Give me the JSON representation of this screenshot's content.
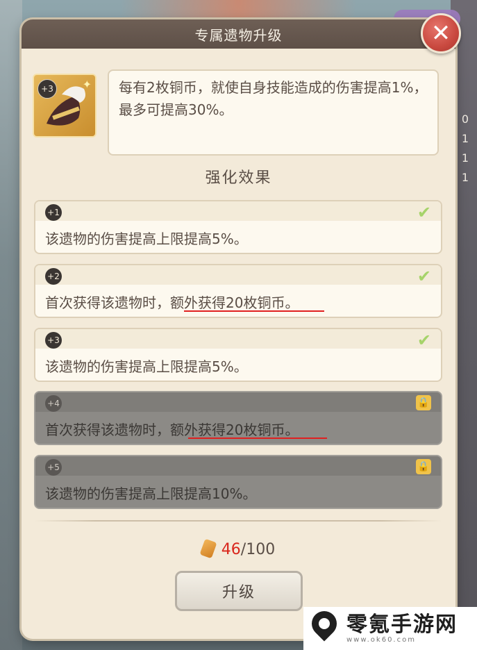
{
  "dialog": {
    "title": "专属遗物升级",
    "close_label": "✕"
  },
  "relic": {
    "level_badge": "+3",
    "description": "每有2枚铜币，就使自身技能造成的伤害提高1%，最多可提高30%。"
  },
  "section_title": "强化效果",
  "effects": [
    {
      "level": "+1",
      "text": "该遗物的伤害提高上限提高5%。",
      "state": "unlocked",
      "status_icon": "check-icon"
    },
    {
      "level": "+2",
      "text_plain": "首次获得该遗物时，",
      "text_highlight": "额外获得20枚铜币。",
      "state": "unlocked",
      "status_icon": "check-icon"
    },
    {
      "level": "+3",
      "text": "该遗物的伤害提高上限提高5%。",
      "state": "unlocked",
      "status_icon": "check-icon"
    },
    {
      "level": "+4",
      "text_plain": "首次获得该遗物时，",
      "text_highlight": "额外获得20枚铜币。",
      "state": "locked",
      "status_icon": "lock-icon"
    },
    {
      "level": "+5",
      "text": "该遗物的伤害提高上限提高10%。",
      "state": "locked",
      "status_icon": "lock-icon"
    }
  ],
  "cost": {
    "current": "46",
    "separator": "/100"
  },
  "upgrade_button": "升级",
  "background": {
    "side_numbers": [
      "0",
      "1",
      "1",
      "1"
    ]
  },
  "watermark": {
    "name": "零氪手游网",
    "url": "www.ok60.com"
  },
  "colors": {
    "highlight_underline": "#e02020",
    "cost_current": "#d9261c",
    "check": "#a6d36a"
  }
}
